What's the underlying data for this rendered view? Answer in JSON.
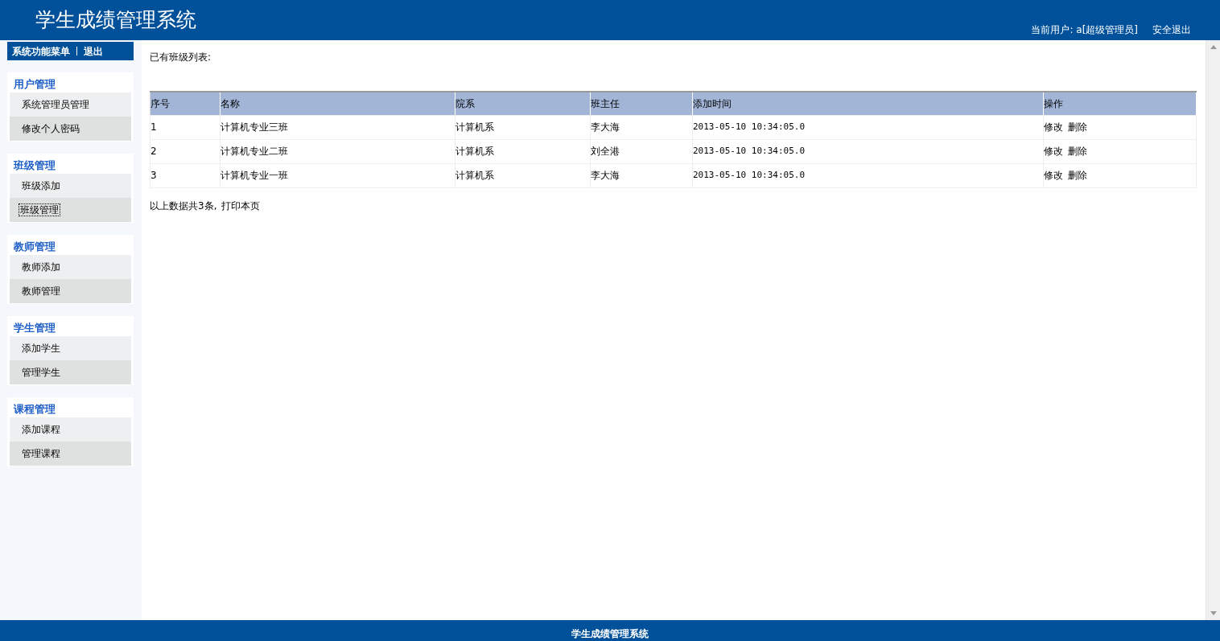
{
  "header": {
    "title": "学生成绩管理系统",
    "user_info": "当前用户: a[超级管理员]",
    "logout": "安全退出"
  },
  "sidebar": {
    "menu_title": "系统功能菜单",
    "exit": "退出",
    "groups": [
      {
        "title": "用户管理",
        "items": [
          {
            "label": "系统管理员管理",
            "selected": false
          },
          {
            "label": "修改个人密码",
            "selected": false
          }
        ]
      },
      {
        "title": "班级管理",
        "items": [
          {
            "label": "班级添加",
            "selected": false
          },
          {
            "label": "班级管理",
            "selected": true
          }
        ]
      },
      {
        "title": "教师管理",
        "items": [
          {
            "label": "教师添加",
            "selected": false
          },
          {
            "label": "教师管理",
            "selected": false
          }
        ]
      },
      {
        "title": "学生管理",
        "items": [
          {
            "label": "添加学生",
            "selected": false
          },
          {
            "label": "管理学生",
            "selected": false
          }
        ]
      },
      {
        "title": "课程管理",
        "items": [
          {
            "label": "添加课程",
            "selected": false
          },
          {
            "label": "管理课程",
            "selected": false
          }
        ]
      }
    ]
  },
  "content": {
    "heading": "已有班级列表:",
    "table": {
      "columns": [
        "序号",
        "名称",
        "院系",
        "班主任",
        "添加时间",
        "操作"
      ],
      "rows": [
        {
          "cells": [
            "1",
            "计算机专业三班",
            "计算机系",
            "李大海",
            "2013-05-10 10:34:05.0"
          ],
          "actions": [
            "修改",
            "删除"
          ]
        },
        {
          "cells": [
            "2",
            "计算机专业二班",
            "计算机系",
            "刘全港",
            "2013-05-10 10:34:05.0"
          ],
          "actions": [
            "修改",
            "删除"
          ]
        },
        {
          "cells": [
            "3",
            "计算机专业一班",
            "计算机系",
            "李大海",
            "2013-05-10 10:34:05.0"
          ],
          "actions": [
            "修改",
            "删除"
          ]
        }
      ]
    },
    "summary": "以上数据共3条,",
    "print_link": "打印本页"
  },
  "footer": {
    "text": "学生成绩管理系统"
  }
}
